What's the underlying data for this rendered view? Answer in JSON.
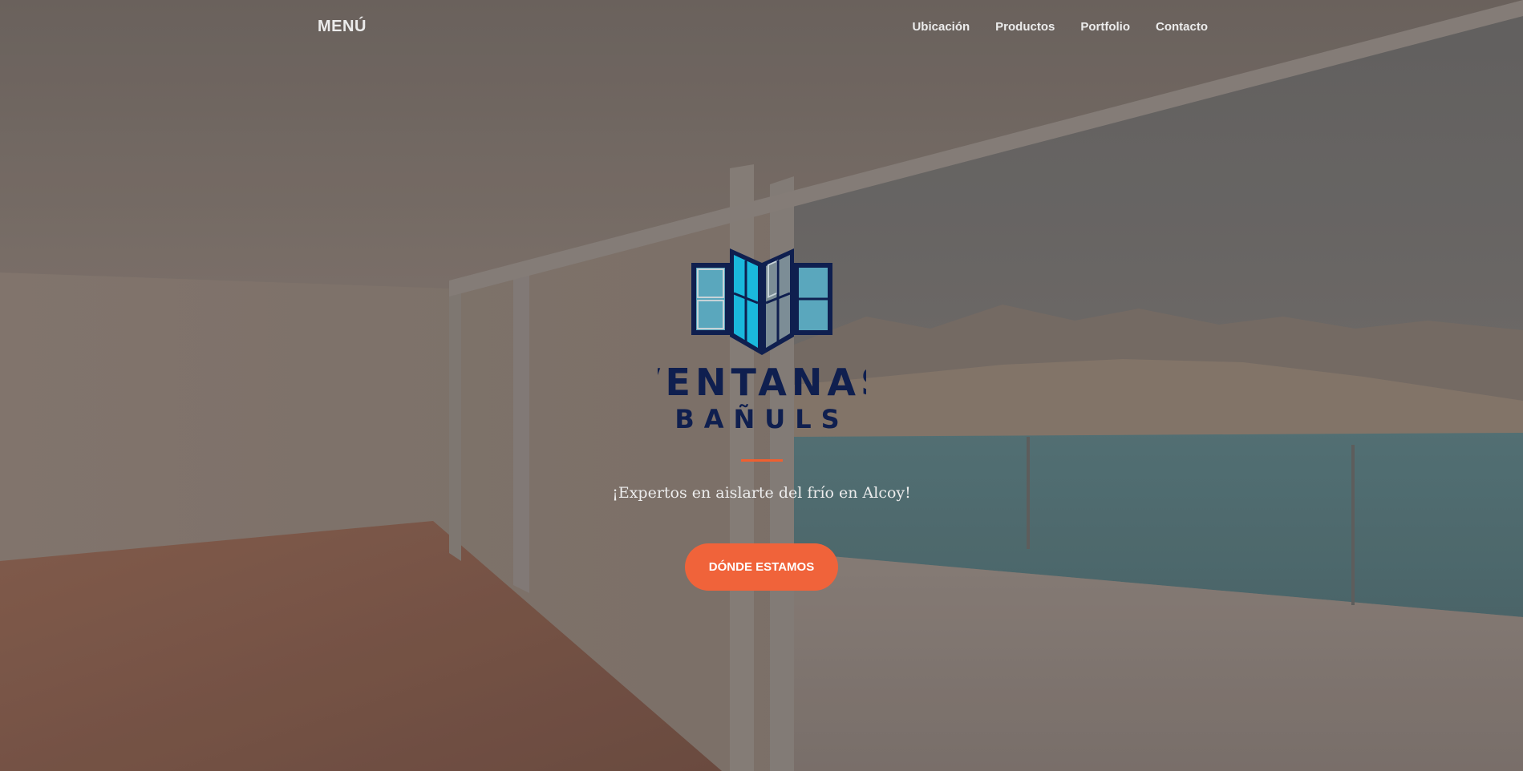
{
  "header": {
    "menu_label": "MENÚ",
    "nav": [
      {
        "label": "Ubicación"
      },
      {
        "label": "Productos"
      },
      {
        "label": "Portfolio"
      },
      {
        "label": "Contacto"
      }
    ]
  },
  "hero": {
    "logo_line1": "VENTANAS",
    "logo_line2": "BAÑULS",
    "tagline": "¡Expertos en aislarte del frío en Alcoy!",
    "cta_label": "DÓNDE ESTAMOS"
  },
  "colors": {
    "accent": "#f05f2f",
    "logo_navy": "#0f1f4f",
    "logo_cyan": "#1ab8dc"
  }
}
